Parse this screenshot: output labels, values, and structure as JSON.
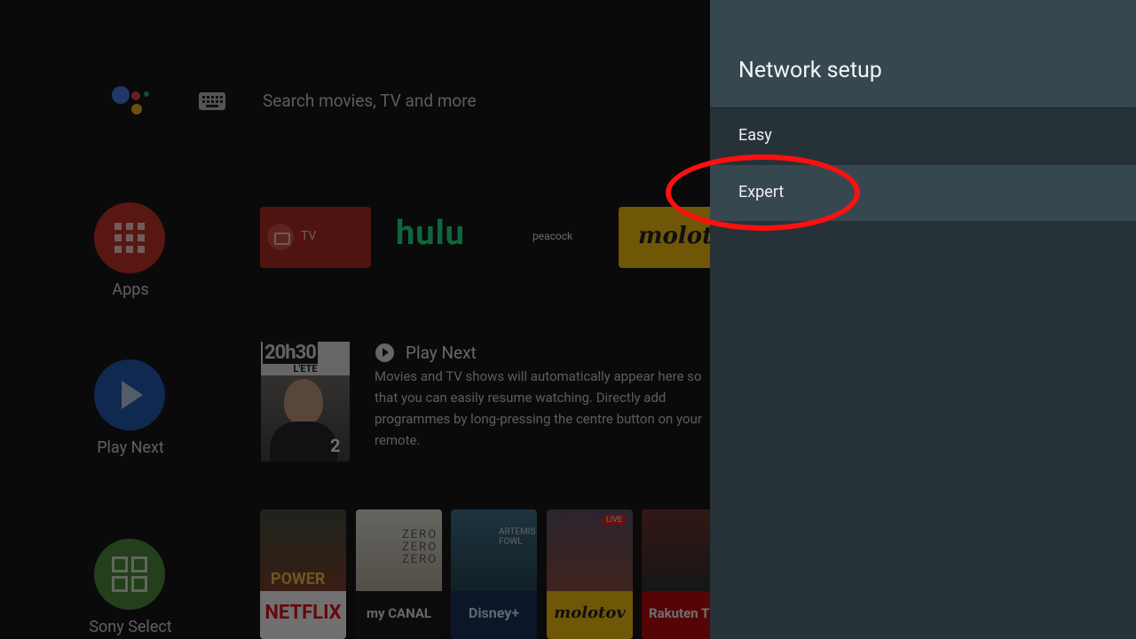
{
  "home": {
    "search_placeholder": "Search movies, TV and more",
    "sidebar": {
      "apps_label": "Apps",
      "play_next_label": "Play Next",
      "sony_select_label": "Sony Select"
    },
    "app_tiles": {
      "tv_label": "TV",
      "hulu_label": "hulu",
      "peacock_label": "peacock",
      "molotov_label": "molotov"
    },
    "play_next": {
      "title": "Play Next",
      "description": "Movies and TV shows will automatically appear here so that you can easily resume watching. Directly add programmes by long-pressing the centre button on your remote.",
      "poster_title": "20h30",
      "poster_subtitle": "L'ETE",
      "poster_channel": "2"
    },
    "content_row": [
      {
        "brand": "NETFLIX",
        "art_text": "POWER"
      },
      {
        "brand": "my CANAL",
        "art_text": "ZERO ZERO ZERO"
      },
      {
        "brand": "Disney+",
        "art_text": "ARTEMIS FOWL"
      },
      {
        "brand": "molotov",
        "art_text": "LIVE"
      },
      {
        "brand": "Rakuten TV",
        "art_text": ""
      }
    ]
  },
  "network_setup": {
    "title": "Network setup",
    "options": [
      {
        "label": "Easy",
        "selected": false
      },
      {
        "label": "Expert",
        "selected": true
      }
    ]
  },
  "colors": {
    "panel_bg": "#263238",
    "panel_header_bg": "#37474f",
    "selected_row_bg": "#37474f",
    "annotation": "#ff1010"
  }
}
